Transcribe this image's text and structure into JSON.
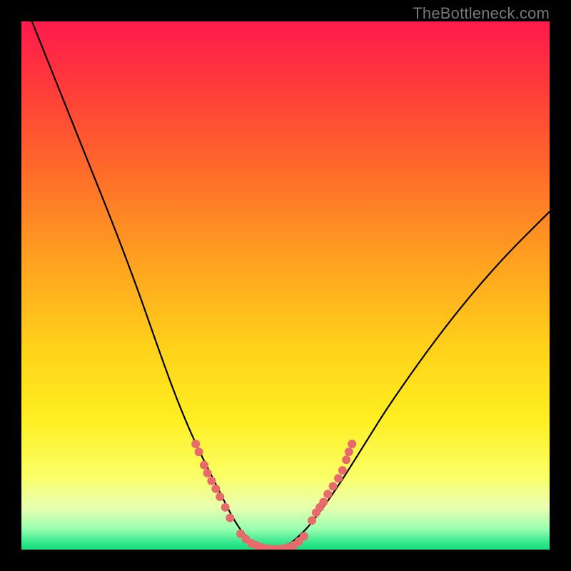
{
  "attribution": "TheBottleneck.com",
  "chart_data": {
    "type": "line",
    "title": "",
    "xlabel": "",
    "ylabel": "",
    "xlim": [
      0,
      100
    ],
    "ylim": [
      0,
      100
    ],
    "grid": false,
    "legend": false,
    "series": [
      {
        "name": "bottleneck-curve",
        "x": [
          2,
          10,
          20,
          27,
          30,
          33,
          36,
          38,
          40,
          42,
          44,
          46,
          48,
          50,
          52,
          55,
          60,
          65,
          70,
          80,
          90,
          100
        ],
        "y": [
          100,
          80,
          55,
          35,
          27,
          20,
          14,
          10,
          6,
          3,
          1,
          0,
          0,
          0.5,
          2,
          5,
          12,
          20,
          28,
          42,
          54,
          64
        ]
      }
    ],
    "marker_clusters": [
      {
        "name": "left-descent-markers",
        "x": [
          33.0,
          33.6,
          34.6,
          35.2,
          36.0,
          36.8,
          37.6,
          38.6,
          39.5,
          41.5,
          42.5,
          43.5
        ],
        "y": [
          20.0,
          18.5,
          16.0,
          14.5,
          13.0,
          11.5,
          10.0,
          8.0,
          6.0,
          3.0,
          2.0,
          1.2
        ]
      },
      {
        "name": "valley-floor-markers",
        "x": [
          44.5,
          45.5,
          46.5,
          47.5,
          48.5,
          49.5,
          50.5,
          51.5,
          52.5,
          53.5
        ],
        "y": [
          0.8,
          0.4,
          0.2,
          0.1,
          0.1,
          0.2,
          0.4,
          0.8,
          1.5,
          2.5
        ]
      },
      {
        "name": "right-ascent-markers",
        "x": [
          55.0,
          55.8,
          56.5,
          57.2,
          58.0,
          59.0,
          60.0,
          60.8,
          61.5,
          62.0,
          62.6
        ],
        "y": [
          5.5,
          7.0,
          8.0,
          9.0,
          10.5,
          12.0,
          13.5,
          15.0,
          17.0,
          18.5,
          20.0
        ]
      }
    ],
    "annotations": [],
    "colors": {
      "curve": "#000000",
      "markers": "#e86a6a",
      "gradient_top": "#ff1a4d",
      "gradient_bottom": "#1edb7c"
    }
  }
}
